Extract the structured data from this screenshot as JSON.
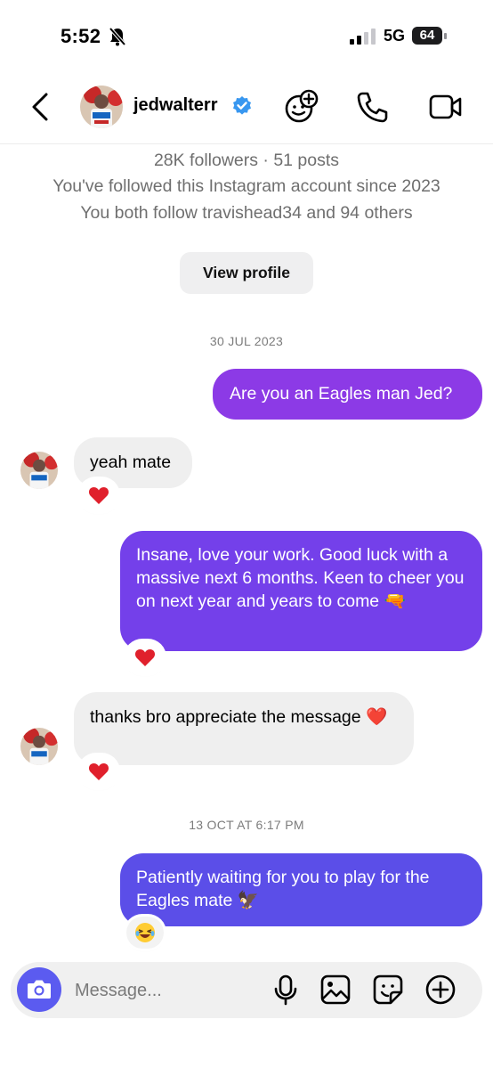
{
  "status_bar": {
    "time": "5:52",
    "network": "5G",
    "battery": "64"
  },
  "header": {
    "username": "jedwalterr"
  },
  "profile_info": {
    "followers_line": "28K followers · 51 posts",
    "followed_since": "You've followed this Instagram account since 2023",
    "mutuals": "You both follow travishead34 and 94 others",
    "view_profile_label": "View profile"
  },
  "messages": {
    "date_1": "30 JUL 2023",
    "m1": "Are you an Eagles man Jed?",
    "m2": "yeah mate",
    "m3": "Insane, love your work. Good luck with a massive next 6 months. Keen to cheer you on next year and years to come 🔫",
    "m4": "thanks bro appreciate the message ❤️",
    "date_2": "13 OCT AT 6:17 PM",
    "m5": "Patiently waiting for you to play for the Eagles mate 🦅"
  },
  "composer": {
    "placeholder": "Message..."
  },
  "colors": {
    "outgoing_1": "#8c3ae6",
    "outgoing_2": "#7440ea",
    "outgoing_3": "#5b4ee8",
    "incoming": "#efefef",
    "camera": "#5b5bf0",
    "verified": "#3897f0"
  }
}
